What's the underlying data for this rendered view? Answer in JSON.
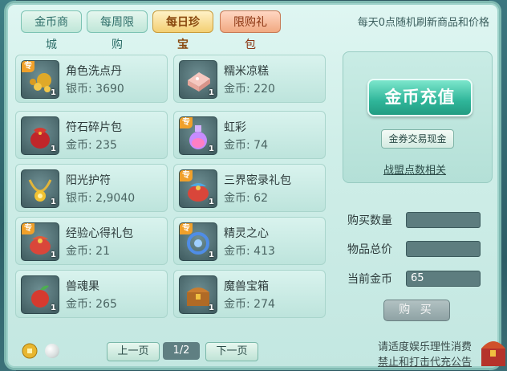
{
  "tabs": [
    {
      "label": "金币商城",
      "state": "normal"
    },
    {
      "label": "每周限购",
      "state": "normal"
    },
    {
      "label": "每日珍宝",
      "state": "active"
    },
    {
      "label": "限购礼包",
      "state": "red"
    }
  ],
  "notice": "每天0点随机刷新商品和价格",
  "items": [
    {
      "name": "角色洗点丹",
      "price": "银币: 3690",
      "qty": "1",
      "exclusive": true,
      "icon": "gold-pills-icon"
    },
    {
      "name": "糯米凉糕",
      "price": "金币: 220",
      "qty": "1",
      "exclusive": false,
      "icon": "rice-cake-icon"
    },
    {
      "name": "符石碎片包",
      "price": "金币: 235",
      "qty": "1",
      "exclusive": false,
      "icon": "red-pouch-icon"
    },
    {
      "name": "虹彩",
      "price": "金币: 74",
      "qty": "1",
      "exclusive": true,
      "icon": "potion-bottle-icon"
    },
    {
      "name": "阳光护符",
      "price": "银币: 2,9040",
      "qty": "1",
      "exclusive": false,
      "icon": "sun-necklace-icon"
    },
    {
      "name": "三界密录礼包",
      "price": "金币: 62",
      "qty": "1",
      "exclusive": true,
      "icon": "gift-pouch-icon"
    },
    {
      "name": "经验心得礼包",
      "price": "金币: 21",
      "qty": "1",
      "exclusive": true,
      "icon": "gift-pouch-icon"
    },
    {
      "name": "精灵之心",
      "price": "金币: 413",
      "qty": "1",
      "exclusive": true,
      "icon": "spirit-heart-icon"
    },
    {
      "name": "兽魂果",
      "price": "金币: 265",
      "qty": "1",
      "exclusive": false,
      "icon": "beast-fruit-icon"
    },
    {
      "name": "魔兽宝箱",
      "price": "金币: 274",
      "qty": "1",
      "exclusive": false,
      "icon": "treasure-chest-icon"
    }
  ],
  "right": {
    "recharge_label": "金币充值",
    "exchange_label": "金券交易现金",
    "alliance_link": "战盟点数相关"
  },
  "form": {
    "qty_label": "购买数量",
    "qty_value": "",
    "total_label": "物品总价",
    "total_value": "",
    "gold_label": "当前金币",
    "gold_value": "65",
    "buy_label": "购 买"
  },
  "pager": {
    "prev": "上一页",
    "indicator": "1/2",
    "next": "下一页"
  },
  "footer": {
    "line1": "请适度娱乐理性消费",
    "line2": "禁止和打击代充公告"
  },
  "colors": {
    "accent": "#2fb599",
    "active_tab": "#f3cf73",
    "field": "#5d7d7f"
  }
}
